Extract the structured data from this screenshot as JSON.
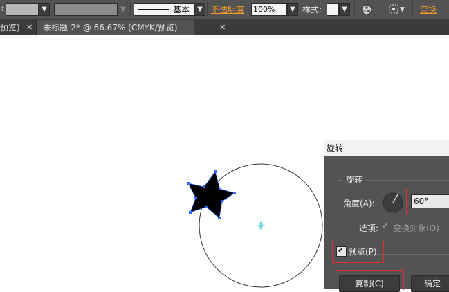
{
  "toolbar": {
    "stroke_profile_label": "基本",
    "opacity_label": "不透明度",
    "opacity_value": "100%",
    "style_label": "样式:",
    "transform_label": "变换"
  },
  "tabs": [
    {
      "label": "预览)"
    },
    {
      "label": "未标题-2* @ 66.67% (CMYK/预览)"
    }
  ],
  "dialog": {
    "title": "旋转",
    "group_label": "旋转",
    "angle_label": "角度(A):",
    "angle_value": "60°",
    "options_label": "选项:",
    "transform_objects_label": "变换对象(O)",
    "preview_label": "预览(P)",
    "copy_button": "复制(C)",
    "ok_button": "确定"
  },
  "colors": {
    "accent": "#f39a2b",
    "highlight": "#e03030",
    "selection": "#2f6bff"
  }
}
